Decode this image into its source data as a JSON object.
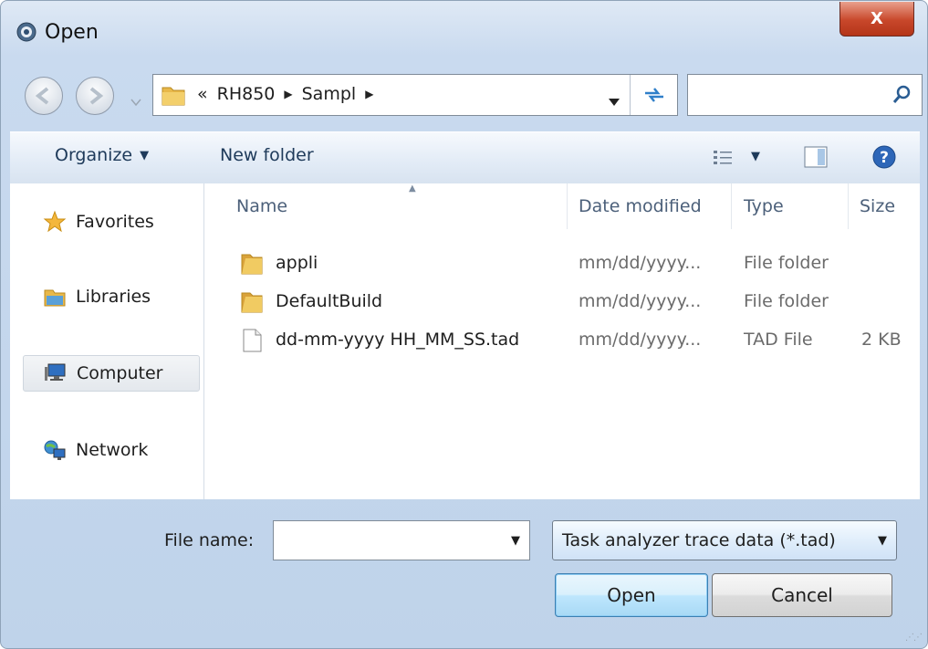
{
  "window": {
    "title": "Open",
    "close_glyph": "X"
  },
  "address": {
    "crumbs": [
      "«",
      "RH850",
      "Sampl"
    ],
    "search_placeholder": ""
  },
  "toolbar": {
    "organize_label": "Organize",
    "new_folder_label": "New folder"
  },
  "nav": [
    {
      "label": "Favorites",
      "icon": "star-icon"
    },
    {
      "label": "Libraries",
      "icon": "libraries-icon"
    },
    {
      "label": "Computer",
      "icon": "computer-icon",
      "selected": true
    },
    {
      "label": "Network",
      "icon": "network-icon"
    }
  ],
  "columns": {
    "name": "Name",
    "date": "Date modified",
    "type": "Type",
    "size": "Size"
  },
  "files": [
    {
      "name": "appli",
      "date": "mm/dd/yyyy...",
      "type": "File folder",
      "size": "",
      "icon": "folder-icon"
    },
    {
      "name": "DefaultBuild",
      "date": "mm/dd/yyyy...",
      "type": "File folder",
      "size": "",
      "icon": "folder-icon"
    },
    {
      "name": "dd-mm-yyyy HH_MM_SS.tad",
      "date": "mm/dd/yyyy...",
      "type": "TAD File",
      "size": "2 KB",
      "icon": "file-icon"
    }
  ],
  "bottom": {
    "file_name_label": "File name:",
    "file_name_value": "",
    "filter_value": "Task analyzer trace data (*.tad)",
    "open_label": "Open",
    "cancel_label": "Cancel"
  },
  "colors": {
    "accent": "#3c7fb1",
    "toolbar_text": "#1e3a5a",
    "close_red": "#c8472a",
    "folder_yellow": "#e8b84a"
  }
}
